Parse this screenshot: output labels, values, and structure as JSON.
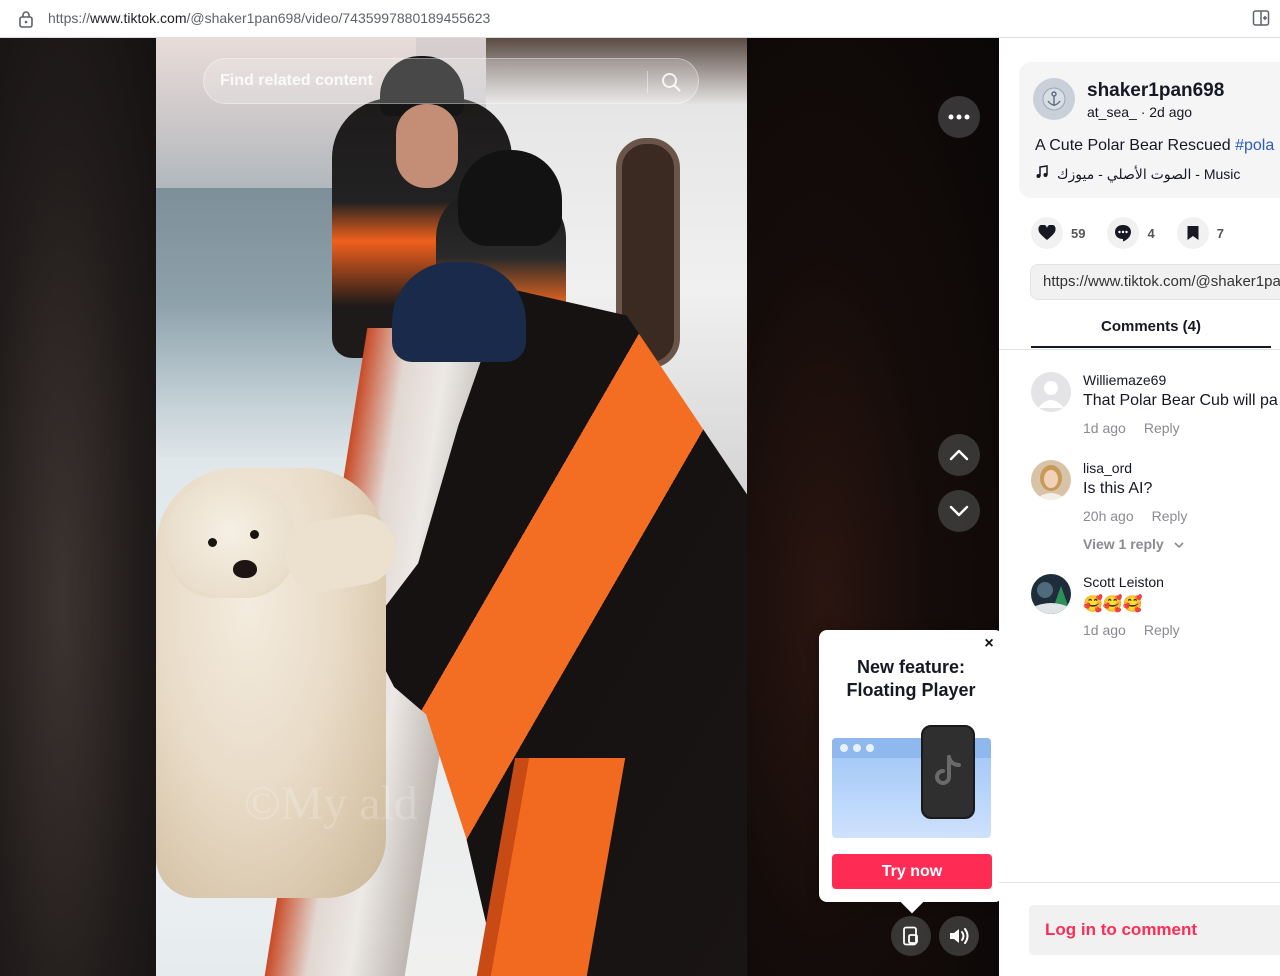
{
  "browser": {
    "url_prefix": "https://",
    "url_host": "www.tiktok.com",
    "url_path": "/@shaker1pan698/video/7435997880189455623"
  },
  "video": {
    "search_placeholder": "Find related content",
    "watermark": "©My          ald"
  },
  "popup": {
    "title_line1": "New feature:",
    "title_line2": "Floating Player",
    "try_label": "Try now",
    "close_glyph": "×"
  },
  "post": {
    "author": "shaker1pan698",
    "sub": "at_sea_ · 2d ago",
    "description": "A Cute Polar Bear Rescued ",
    "hashtag": "#pola",
    "music": "الصوت الأصلي - ميوزك - Music",
    "likes": "59",
    "comments_count": "4",
    "saves": "7",
    "link": "https://www.tiktok.com/@shaker1pan"
  },
  "tabs": {
    "comments_label": "Comments (4)"
  },
  "comments": [
    {
      "user": "Williemaze69",
      "text": "That Polar Bear Cub will pa",
      "time": "1d ago",
      "reply": "Reply"
    },
    {
      "user": "lisa_ord",
      "text": "Is this AI?",
      "time": "20h ago",
      "reply": "Reply",
      "view_replies": "View 1 reply"
    },
    {
      "user": "Scott Leiston",
      "text": "🥰🥰🥰",
      "time": "1d ago",
      "reply": "Reply"
    }
  ],
  "login": {
    "label": "Log in to comment"
  },
  "colors": {
    "brand": "#fe2c55",
    "hashtag": "#2b5db9"
  }
}
